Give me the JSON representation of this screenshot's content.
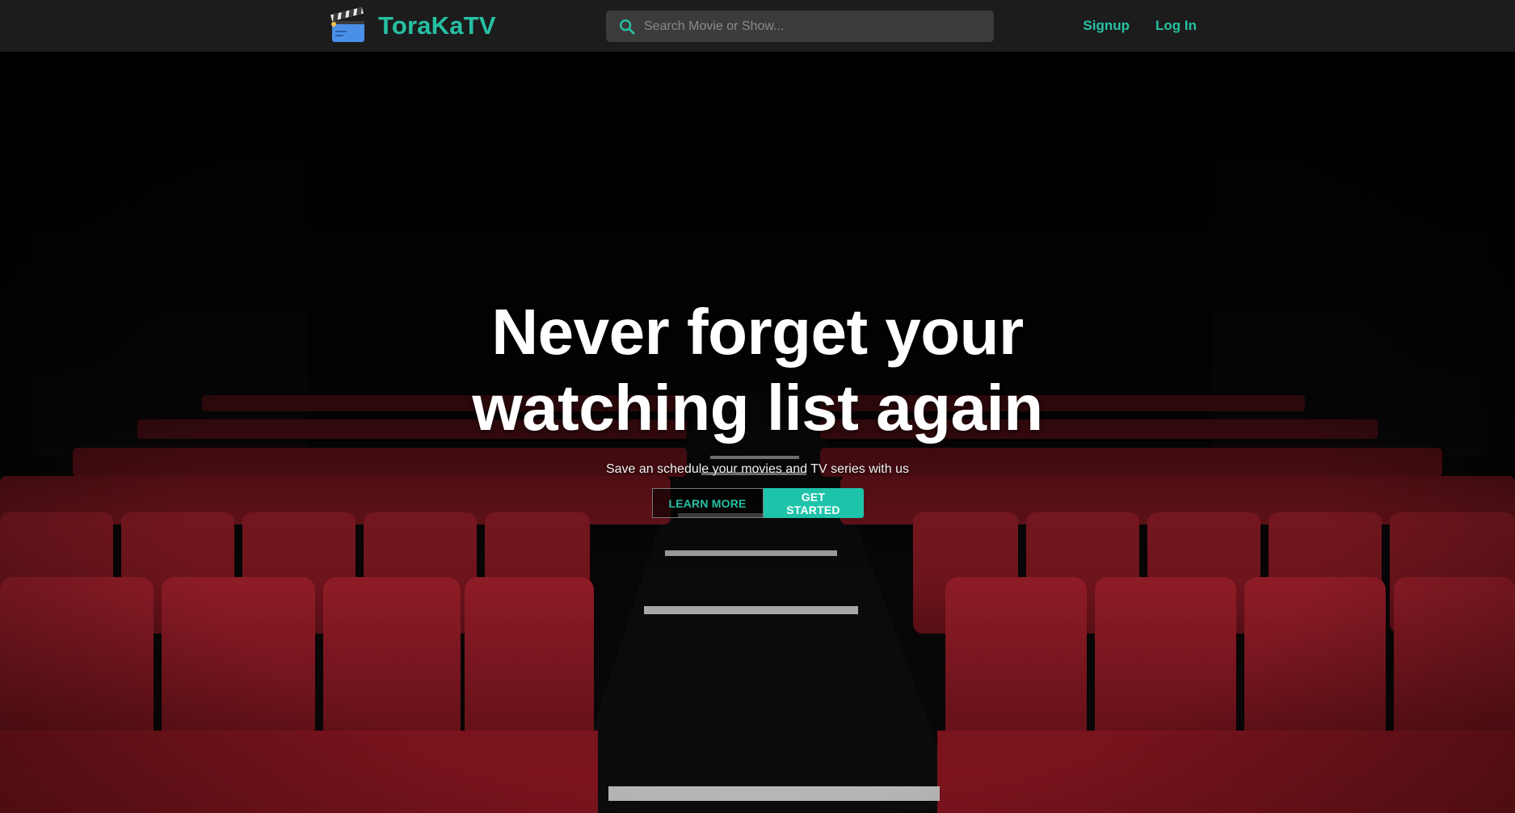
{
  "brand": {
    "name": "ToraKaTV",
    "logo_icon": "clapperboard-icon",
    "accent_color": "#26c0a3"
  },
  "search": {
    "placeholder": "Search Movie or Show...",
    "value": "",
    "icon": "search-icon"
  },
  "nav": {
    "signup_label": "Signup",
    "login_label": "Log In"
  },
  "hero": {
    "title_line1": "Never forget your",
    "title_line2": "watching list again",
    "subtitle": "Save an schedule your movies and TV series with us",
    "learn_more_label": "LEARN MORE",
    "get_started_label": "GET STARTED",
    "background": "cinema-seats-image"
  }
}
